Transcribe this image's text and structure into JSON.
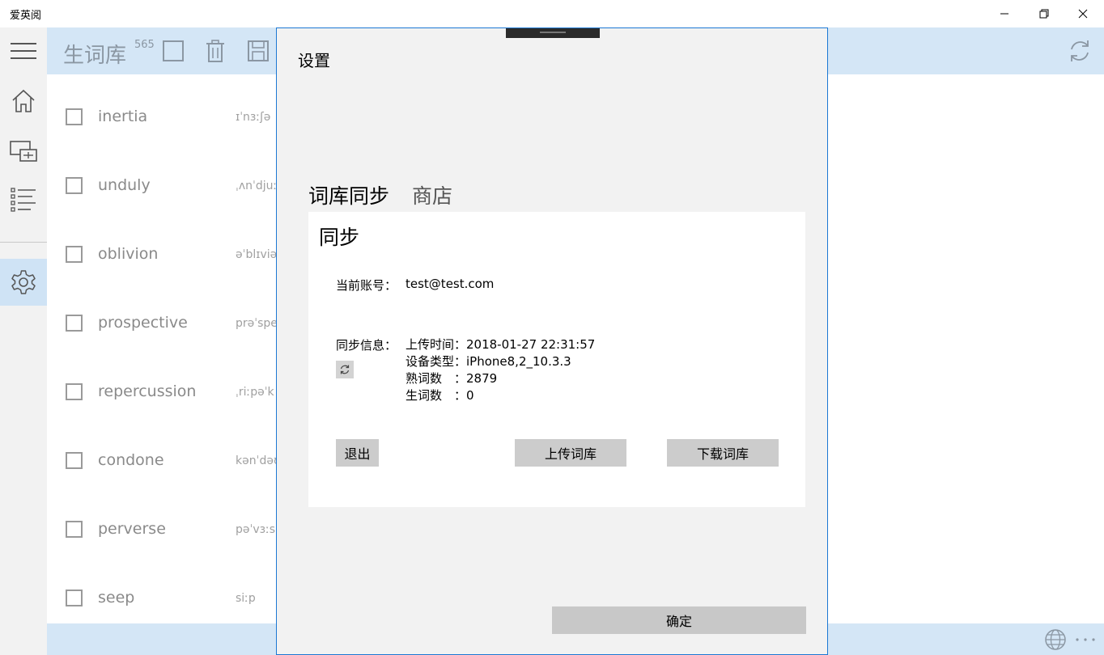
{
  "app": {
    "title": "爱英阅"
  },
  "toolbar": {
    "title": "生词库",
    "count": "565"
  },
  "words": [
    {
      "word": "inertia",
      "phonetic": "ɪˈnɜːʃə"
    },
    {
      "word": "unduly",
      "phonetic": "ˌʌnˈdjuː"
    },
    {
      "word": "oblivion",
      "phonetic": "əˈblɪviə"
    },
    {
      "word": "prospective",
      "phonetic": "prəˈspe"
    },
    {
      "word": "repercussion",
      "phonetic": "ˌriːpəˈk"
    },
    {
      "word": "condone",
      "phonetic": "kənˈdəʊ"
    },
    {
      "word": "perverse",
      "phonetic": "pəˈvɜːs"
    },
    {
      "word": "seep",
      "phonetic": "siːp"
    }
  ],
  "dialog": {
    "title": "设置",
    "tabs": [
      "词库同步",
      "商店"
    ],
    "panel_title": "同步",
    "account_label": "当前账号：",
    "account_value": "test@test.com",
    "sync_label": "同步信息：",
    "sync_info": [
      "上传时间：2018-01-27 22:31:57",
      "设备类型：iPhone8,2_10.3.3",
      "熟词数　：2879",
      "生词数　：0"
    ],
    "logout_label": "退出",
    "upload_label": "上传词库",
    "download_label": "下载词库",
    "ok_label": "确定"
  },
  "colors": {
    "accent": "#1c78d4",
    "bar": "#d4e6f6",
    "nav_active": "#cfe3f5"
  }
}
